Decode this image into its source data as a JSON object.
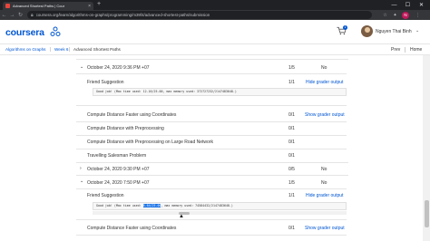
{
  "browser": {
    "tab_title": "Advanced Shortest Paths | Cour",
    "url": "coursera.org/learn/algorithms-on-graphs/programming/m39f4/advanced-shortest-paths/submission",
    "profile_initial": "N"
  },
  "header": {
    "logo": "coursera",
    "notification_count": "1",
    "user_name": "Nguyen Thai Binh",
    "accent": "#0056d2"
  },
  "breadcrumb": {
    "items": [
      "Algorithms on Graphs",
      "Week 6",
      "Advanced Shortest Paths"
    ],
    "prev": "Prev",
    "home": "Home"
  },
  "submissions": {
    "s1": {
      "date": "October 24, 2020 9:36 PM +07",
      "score": "1/5",
      "passed": "No"
    },
    "s1_items": [
      {
        "name": "Friend Suggestion",
        "score": "1/1",
        "link": "Hide grader output",
        "output": "Good job! (Max time used: 12.16/25.00, max memory used: 372727232/2147483648.)"
      },
      {
        "name": "Compute Distance Faster using Coordinates",
        "score": "0/1",
        "link": "Show grader output"
      },
      {
        "name": "Compute Distance with Preprocessing",
        "score": "0/1"
      },
      {
        "name": "Compute Distance with Preprocessing on Large Road Network",
        "score": "0/1"
      },
      {
        "name": "Travelling Salesman Problem",
        "score": "0/1"
      }
    ],
    "s2": {
      "date": "October 24, 2020 9:30 PM +07",
      "score": "0/5",
      "passed": "No"
    },
    "s3": {
      "date": "October 24, 2020 7:50 PM +07",
      "score": "1/5",
      "passed": "No"
    },
    "s3_items": [
      {
        "name": "Friend Suggestion",
        "score": "1/1",
        "link": "Hide grader output",
        "output_pre": "Good job! (Max time used: ",
        "output_hl": "8.64/25.00",
        "output_post": ", max memory used: 74584432/2147483648.)"
      },
      {
        "name": "Compute Distance Faster using Coordinates",
        "score": "0/1",
        "link": "Show grader output"
      }
    ]
  }
}
